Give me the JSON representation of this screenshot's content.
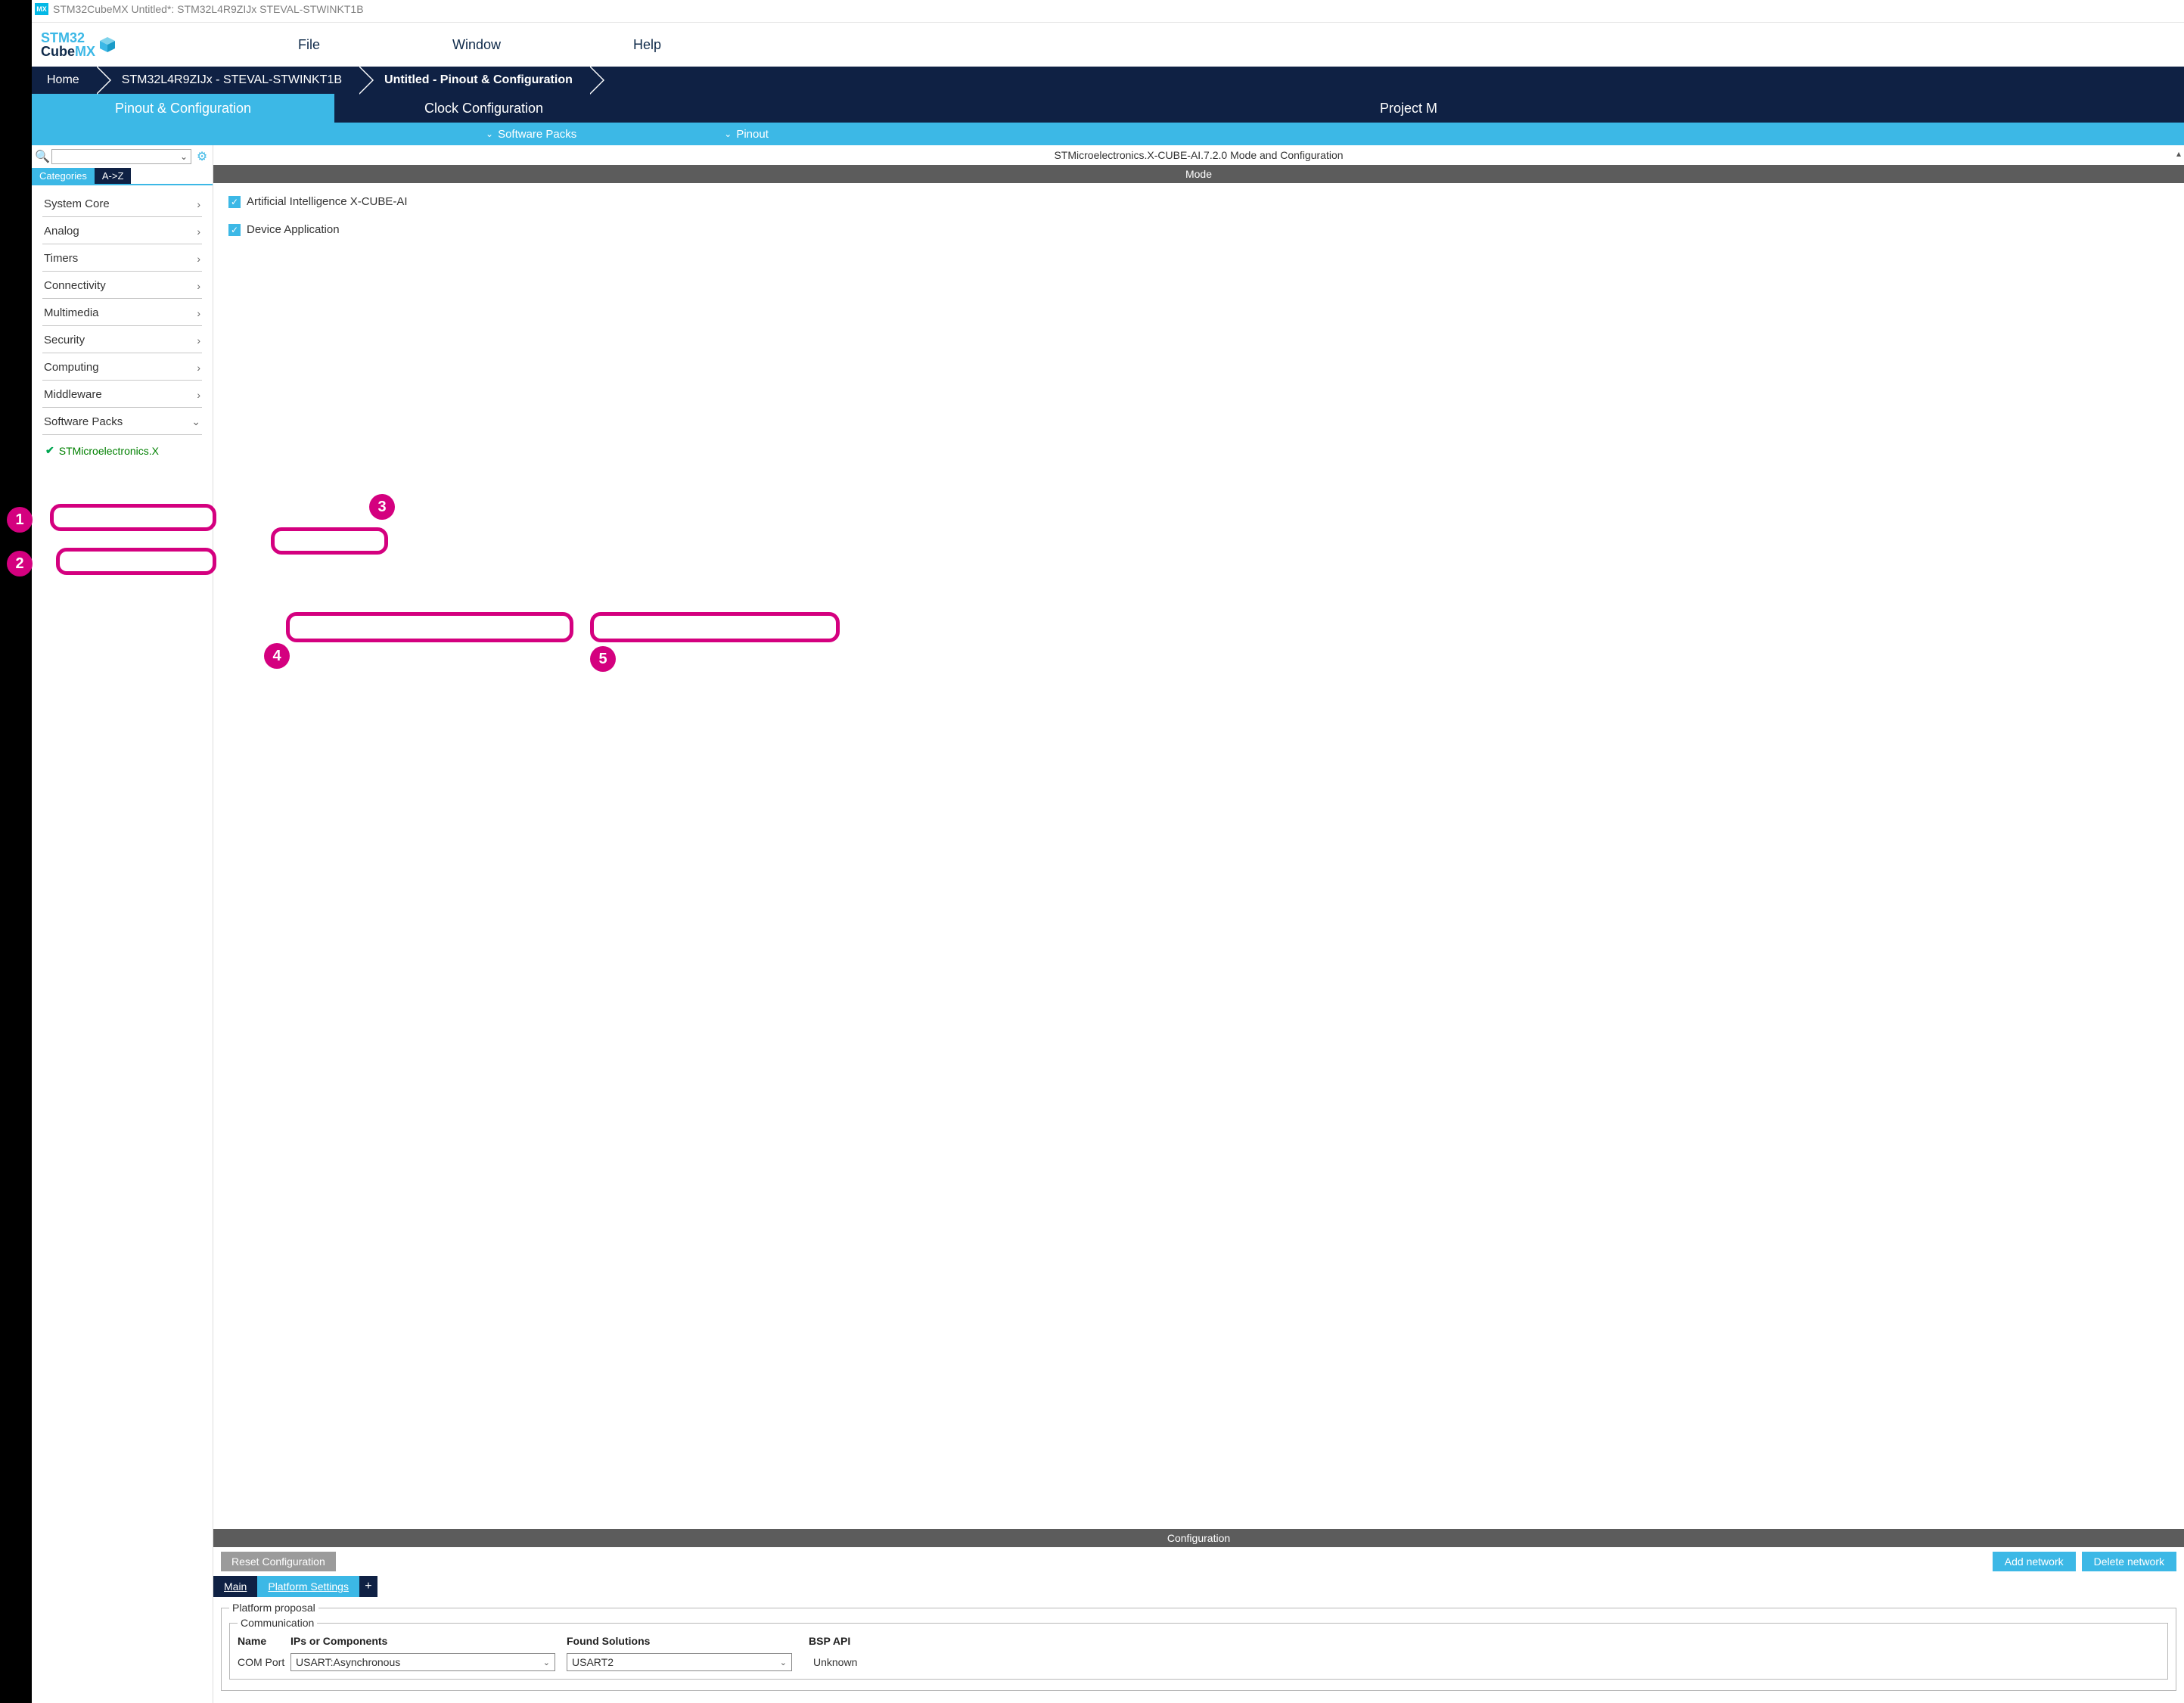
{
  "window_title": "STM32CubeMX Untitled*: STM32L4R9ZIJx STEVAL-STWINKT1B",
  "title_icon_text": "MX",
  "logo": {
    "line1": "STM32",
    "line2a": "Cube",
    "line2b": "MX"
  },
  "topmenu": {
    "file": "File",
    "window": "Window",
    "help": "Help"
  },
  "breadcrumbs": {
    "home": "Home",
    "chip": "STM32L4R9ZIJx  -  STEVAL-STWINKT1B",
    "current": "Untitled - Pinout & Configuration"
  },
  "maintabs": {
    "pinout": "Pinout & Configuration",
    "clock": "Clock Configuration",
    "project": "Project M"
  },
  "subtool": {
    "swpacks": "Software Packs",
    "pinout": "Pinout"
  },
  "sidebar": {
    "tabs": {
      "categories": "Categories",
      "az": "A->Z"
    },
    "items": [
      "System Core",
      "Analog",
      "Timers",
      "Connectivity",
      "Multimedia",
      "Security",
      "Computing",
      "Middleware"
    ],
    "software_packs": "Software Packs",
    "sub_item": "STMicroelectronics.X"
  },
  "content": {
    "title": "STMicroelectronics.X-CUBE-AI.7.2.0 Mode and Configuration",
    "mode_header": "Mode",
    "check_ai": "Artificial Intelligence X-CUBE-AI",
    "check_app": "Device Application",
    "checkmark_glyph": "✓"
  },
  "config_panel": {
    "header": "Configuration",
    "reset_btn": "Reset Configuration",
    "add_btn": "Add network",
    "del_btn": "Delete network",
    "tabs": {
      "main": "Main",
      "platform": "Platform Settings",
      "plus": "+"
    },
    "fieldset1_legend": "Platform proposal",
    "fieldset2_legend": "Communication",
    "headers": {
      "name": "Name",
      "ips": "IPs or Components",
      "found": "Found Solutions",
      "bsp": "BSP API"
    },
    "row1": {
      "name": "COM Port",
      "ips": "USART:Asynchronous",
      "found": "USART2",
      "bsp": "Unknown"
    }
  },
  "annotations": {
    "n1": "1",
    "n2": "2",
    "n3": "3",
    "n4": "4",
    "n5": "5"
  }
}
